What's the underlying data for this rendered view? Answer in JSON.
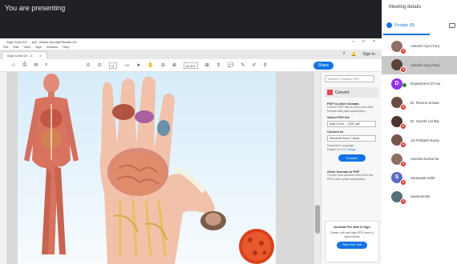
{
  "presenting": {
    "text": "You are presenting"
  },
  "acrobat": {
    "title": "Supt Covid 19 - ...pdf - Adobe Acrobat Reader DC",
    "window_buttons": [
      "–",
      "□",
      "×"
    ],
    "menu": [
      "File",
      "Edit",
      "View",
      "Sign",
      "Window",
      "Help"
    ],
    "tab_label": "Supt Covid 19 - 2...",
    "help_glyph": "?",
    "sign_in": "Sign In",
    "toolbar": {
      "page": "11",
      "page_total": "/ 22",
      "zoom": "80.6%",
      "share": "Share"
    },
    "right_pane": {
      "search_placeholder": "Search 'Combine PDF'",
      "convert_title": "Convert",
      "pdf_to_other": "PDF to other formats",
      "pdf_to_other_desc": "Convert PDF files to Word and other formats with paid subscription.",
      "select_file_label": "Select PDF file",
      "select_file_value": "Supt Covid ... 2020 .pdf",
      "convert_to_label": "Convert to",
      "convert_to_value": "Microsoft Word (*.docx)",
      "doc_language_label": "Document Language",
      "doc_language_value": "English (U.S.)",
      "change_link": "Change",
      "convert_button": "Convert",
      "other_formats": "Other formats to PDF",
      "other_formats_desc": "Convert and combine other files into PDFs with a paid subscription.",
      "promo_title": "Acrobat Pro with E-Sign",
      "promo_sub": "Create, edit and sign PDF forms & agreements",
      "promo_button": "Start Free Trial"
    }
  },
  "meeting": {
    "title": "Meeting details",
    "people_tab": "People (9)",
    "participants": [
      {
        "name": "Ankesh Arya (You)",
        "initial": "",
        "color": "#8d6e63"
      },
      {
        "name": "Ankesh Arya (You)",
        "initial": "",
        "color": "#5d4037"
      },
      {
        "name": "Department Of You",
        "initial": "D",
        "color": "#9334e6"
      },
      {
        "name": "Dr. Reema Srivast",
        "initial": "",
        "color": "#6d4c41"
      },
      {
        "name": "Dr. Suresh Lal Bar",
        "initial": "",
        "color": "#4e342e"
      },
      {
        "name": "Jai Prakash Naray",
        "initial": "",
        "color": "#795548"
      },
      {
        "name": "ravindra kumar ba",
        "initial": "",
        "color": "#8d6e63"
      },
      {
        "name": "Saraswati Kalla",
        "initial": "S",
        "color": "#5c6bc0"
      },
      {
        "name": "siwamamala",
        "initial": "",
        "color": "#546e7a"
      }
    ]
  },
  "colors": {
    "accent": "#1a73e8",
    "mute_red": "#d93025",
    "acrobat_blue": "#1473e6"
  }
}
